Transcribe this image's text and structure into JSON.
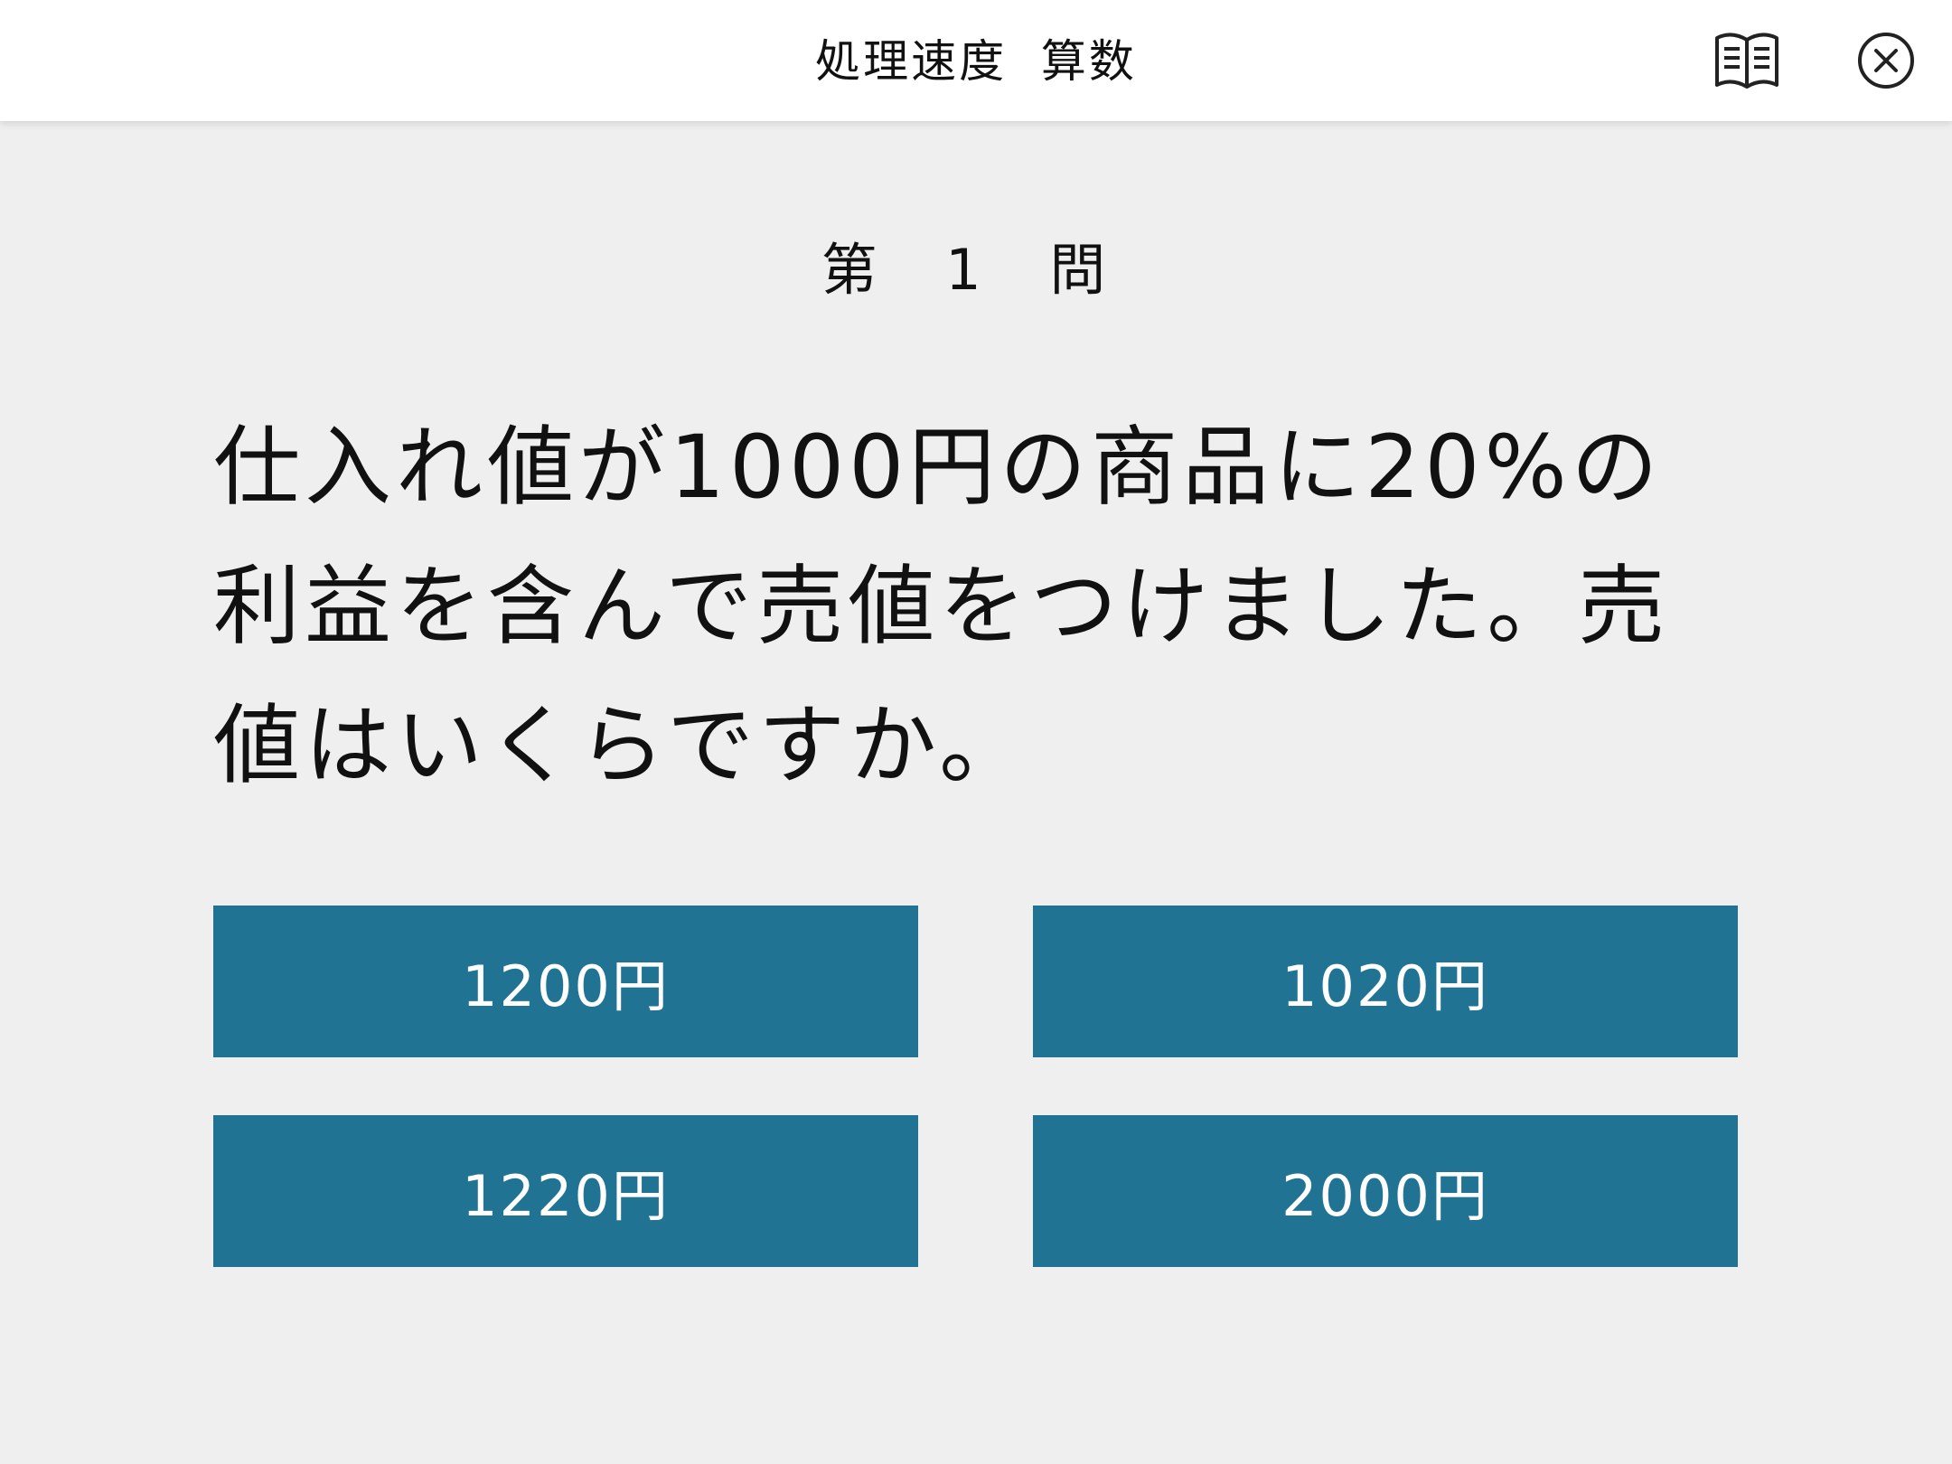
{
  "header": {
    "title": "処理速度  算数",
    "book_icon": "open-book-icon",
    "close_icon": "close-circle-icon"
  },
  "question": {
    "number_label": "第 1 問",
    "text": "仕入れ値が1000円の商品に20%の利益を含んで売値をつけました。売値はいくらですか。"
  },
  "answers": [
    {
      "label": "1200円"
    },
    {
      "label": "1020円"
    },
    {
      "label": "1220円"
    },
    {
      "label": "2000円"
    }
  ],
  "colors": {
    "background": "#efefef",
    "header": "#ffffff",
    "answer_button": "#217394",
    "answer_text": "#ffffff"
  }
}
